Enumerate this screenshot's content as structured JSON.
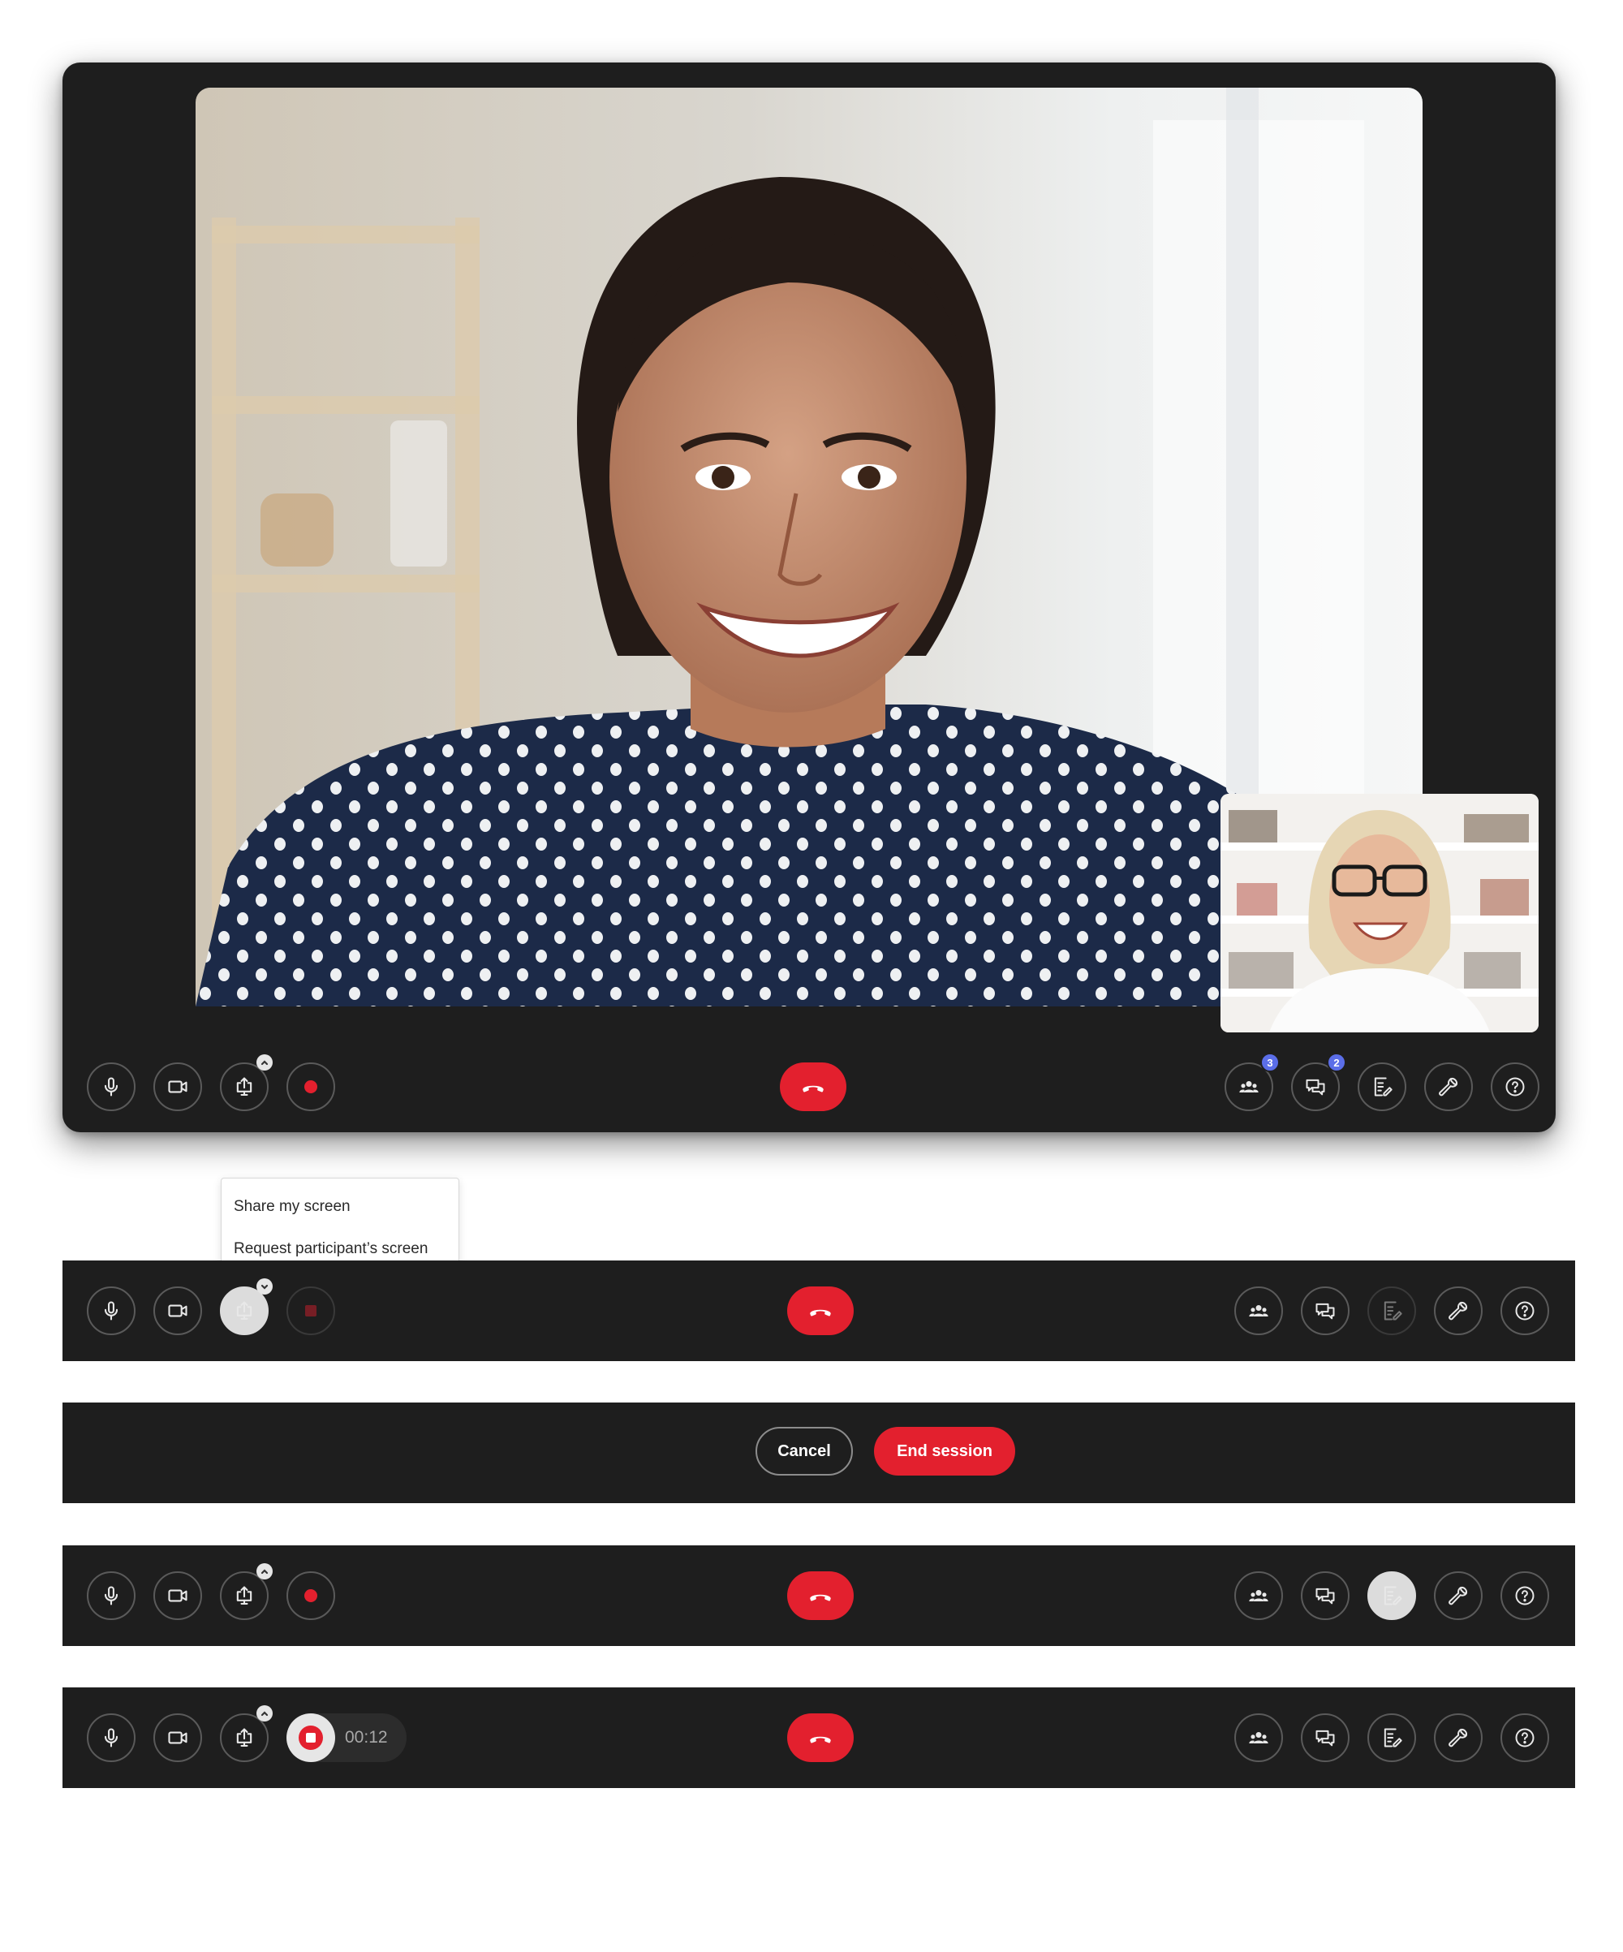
{
  "colors": {
    "accent_red": "#e3202e",
    "toolbar_bg": "#1e1e1e",
    "badge_blue": "#5b6ee8"
  },
  "participants_badge": "3",
  "chat_badge": "2",
  "share_menu": {
    "share_my_screen": "Share my screen",
    "request_participant_screen": "Request participant’s screen"
  },
  "confirm_bar": {
    "cancel_label": "Cancel",
    "end_session_label": "End session"
  },
  "recording_timer": "00:12",
  "icons": [
    "microphone-icon",
    "camera-icon",
    "share-screen-icon",
    "record-icon",
    "hang-up-icon",
    "participants-icon",
    "chat-icon",
    "notes-icon",
    "settings-wrench-icon",
    "help-icon"
  ]
}
